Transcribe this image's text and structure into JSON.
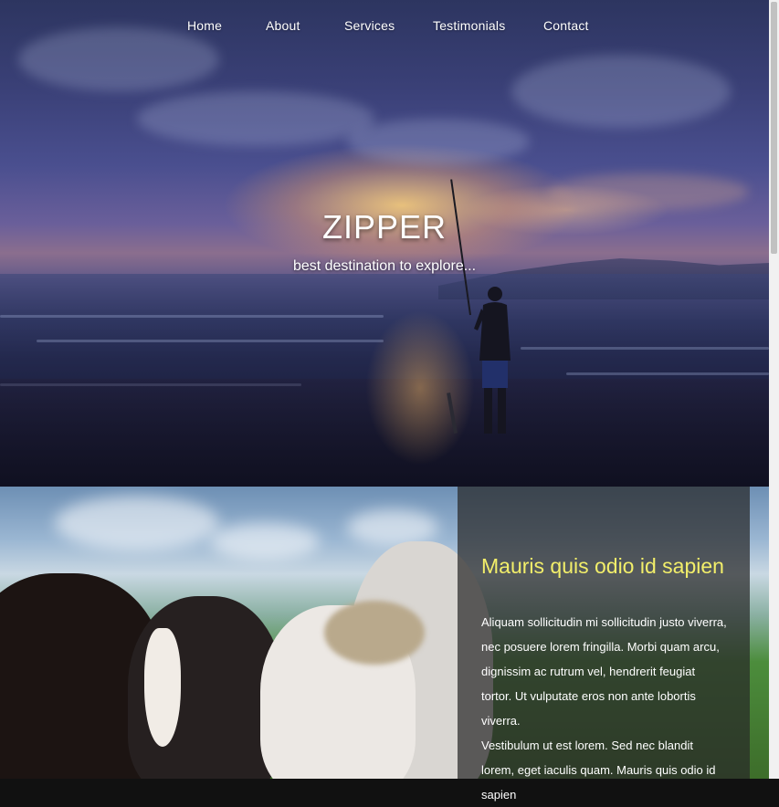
{
  "nav": {
    "items": [
      "Home",
      "About",
      "Services",
      "Testimonials",
      "Contact"
    ]
  },
  "hero": {
    "title": "ZIPPER",
    "subtitle": "best destination to explore..."
  },
  "feature": {
    "heading": "Mauris quis odio id sapien",
    "paragraph_1": "Aliquam sollicitudin mi sollicitudin justo viverra, nec posuere lorem fringilla. Morbi quam arcu, dignissim ac rutrum vel, hendrerit feugiat tortor. Ut vulputate eros non ante lobortis viverra.",
    "paragraph_2": "Vestibulum ut est lorem. Sed nec blandit lorem, eget iaculis quam. Mauris quis odio id sapien"
  },
  "colors": {
    "heading_accent": "#f2ee6a",
    "panel_overlay": "rgba(40,40,40,0.72)"
  }
}
